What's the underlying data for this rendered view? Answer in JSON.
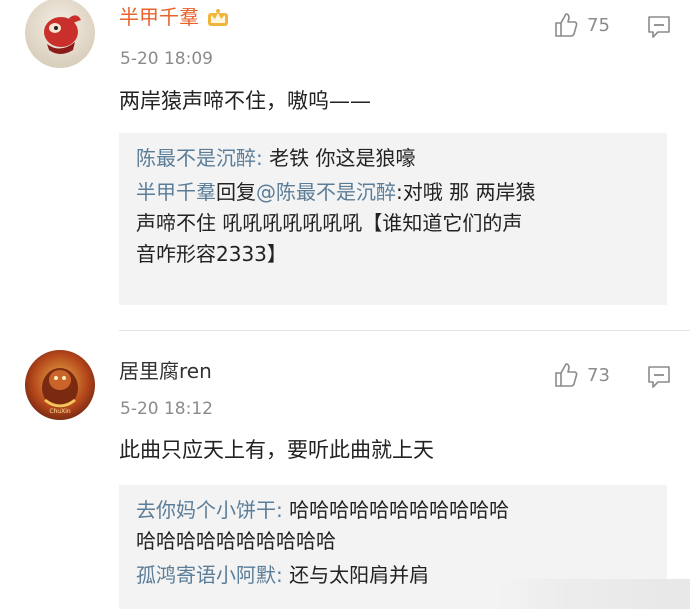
{
  "comments": [
    {
      "username": "半甲千羣",
      "timestamp": "5-20 18:09",
      "likes": "75",
      "text": "两岸猿声啼不住，嗷呜——",
      "replies": [
        {
          "user": "陈最不是沉醉",
          "sep": ": ",
          "text": "老铁 你这是狼嚎"
        },
        {
          "user": "半甲千羣",
          "mid": "回复",
          "mention": "@陈最不是沉醉",
          "sep": ":",
          "text": "对哦 那 两岸猿",
          "text2": "声啼不住 吼吼吼吼吼吼吼【谁知道它们的声",
          "text3": "音咋形容2333】"
        }
      ]
    },
    {
      "username": "居里腐ren",
      "timestamp": "5-20 18:12",
      "likes": "73",
      "text": "此曲只应天上有，要听此曲就上天",
      "replies": [
        {
          "user": "去你妈个小饼干",
          "sep": ": ",
          "text": "哈哈哈哈哈哈哈哈哈哈哈",
          "text2": "哈哈哈哈哈哈哈哈哈哈"
        },
        {
          "user": "孤鸿寄语小阿默",
          "sep": ": ",
          "text": "还与太阳肩并肩"
        }
      ]
    }
  ],
  "icons": {
    "like": "thumbs-up-icon",
    "reply": "comment-icon",
    "vip": "crown-badge-icon"
  },
  "colors": {
    "username_vip": "#e8632b",
    "reply_user": "#5b7d98",
    "quote_bg": "#f3f3f3",
    "muted": "#8b8b8b"
  }
}
